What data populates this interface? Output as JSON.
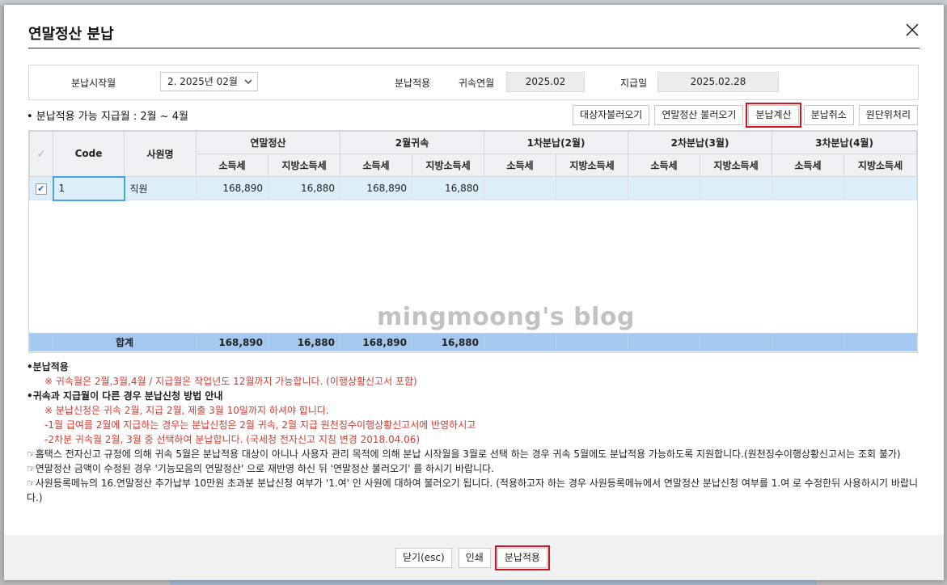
{
  "dialog": {
    "title": "연말정산 분납"
  },
  "filter": {
    "start_label": "분납시작월",
    "start_value": "2. 2025년 02월",
    "apply_label": "분납적용",
    "belong_label": "귀속연월",
    "belong_value": "2025.02",
    "pay_label": "지급일",
    "pay_value": "2025.02.28"
  },
  "range_text": "• 분납적용 가능 지급월 : 2월 ~ 4월",
  "toolbar": {
    "load_targets": "대상자불러오기",
    "load_year_end": "연말정산 불러오기",
    "calc": "분납계산",
    "cancel": "분납취소",
    "source_process": "원단위처리"
  },
  "table": {
    "headers": {
      "code": "Code",
      "name": "사원명",
      "group1": "연말정산",
      "group2": "2월귀속",
      "group3": "1차분납(2월)",
      "group4": "2차분납(3월)",
      "group5": "3차분납(4월)",
      "income": "소득세",
      "local": "지방소득세"
    },
    "rows": [
      {
        "code": "1",
        "name": "직원",
        "ye_income": "168,890",
        "ye_local": "16,880",
        "feb_income": "168,890",
        "feb_local": "16,880",
        "i1_income": "",
        "i1_local": "",
        "i2_income": "",
        "i2_local": "",
        "i3_income": "",
        "i3_local": ""
      }
    ],
    "total": {
      "label": "합계",
      "ye_income": "168,890",
      "ye_local": "16,880",
      "feb_income": "168,890",
      "feb_local": "16,880"
    }
  },
  "watermark": "mingmoong's blog",
  "notes": {
    "h1": "•분납적용",
    "r1": "※ 귀속월은 2월,3월,4월 / 지급월은 작업년도 12월까지 가능합니다. (이행상황신고서 포함)",
    "h2": "•귀속과 지급월이 다른 경우 분납신청 방법 안내",
    "r2": "※ 분납신청은 귀속 2월, 지급 2월, 제출 3월 10일까지 하셔야 합니다.",
    "r3": "-1월 급여를 2월에 지급하는 경우는 분납신청은 2월 귀속, 2월 지급 원천징수이행상황신고서에 반영하시고",
    "r4": "-2차분 귀속월 2월, 3월 중 선택하여 분납합니다. (국세청 전자신고 지침 변경 2018.04.06)",
    "p1": "☞홈택스 전자신고 규정에 의해 귀속 5월은 분납적용 대상이 아니나 사용자 관리 목적에 의해 분납 시작월을 3월로 선택 하는 경우 귀속 5월에도 분납적용 가능하도록 지원합니다.(원천징수이행상황신고서는 조회 불가)",
    "p2": "☞연말정산 금액이 수정된 경우 '기능모음의 연말정산' 으로 재반영 하신 뒤 '연말정산 불러오기' 를 하시기 바랍니다.",
    "p3": "☞사원등록메뉴의 16.연말정산 추가납부 10만원 초과분 분납신청 여부가 '1.여' 인 사원에 대하여 불러오기 됩니다. (적용하고자 하는 경우 사원등록메뉴에서 연말정산 분납신청 여부를 1.여 로 수정한뒤 사용하시기 바랍니다.)"
  },
  "footer": {
    "close": "닫기(esc)",
    "print": "인쇄",
    "apply": "분납적용"
  },
  "colors": {
    "highlight": "#d0141d",
    "selected_row": "#dbeefa",
    "total_row": "#a6c8ee",
    "notice_red": "#d43a2f"
  }
}
